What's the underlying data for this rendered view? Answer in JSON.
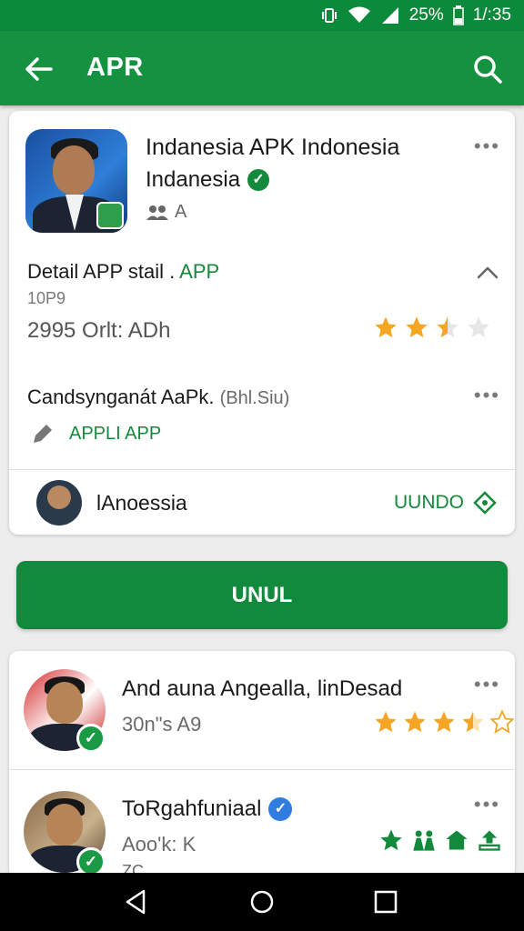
{
  "status_bar": {
    "battery": "25%",
    "time": "1/:35",
    "icons": [
      "vibrate-icon",
      "wifi-icon",
      "signal-icon",
      "battery-icon"
    ]
  },
  "app_bar": {
    "title": "APR",
    "back_icon": "arrow-left-icon",
    "search_icon": "search-icon"
  },
  "app_card": {
    "title": "Indanesia APK Indonesia",
    "developer": "Indanesia",
    "verified_mark": "✓",
    "meta": "A",
    "detail_label": "Detail APP stail .",
    "detail_label_accent": "APP",
    "detail_code": "10P9",
    "detail_stat": "2995 Orlt: ADh",
    "rating": 2.5,
    "subheading": "Candsynganát AaPk.",
    "subheading_muted": "(Bhl.Siu)",
    "apply_label": "APPLI APP",
    "developer_row_name": "lAnoessia",
    "developer_row_action": "UUNDO"
  },
  "primary_button": {
    "label": "UNUL"
  },
  "list": {
    "items": [
      {
        "title": "And auna Angealla, linDesad",
        "subtitle": "30n\"s A9",
        "rating": 3.5,
        "verified_mark": "✓"
      },
      {
        "title": "ToRgahfuniaal",
        "subtitle": "Aoo'k: K",
        "subtitle2": "ZC",
        "verified_mark": "✓",
        "blue_check": "✓"
      }
    ]
  },
  "colors": {
    "brand_green": "#14923f",
    "status_green": "#0b8a3c",
    "accent_green": "#138a3b",
    "star_yellow": "#f5a623",
    "verify_blue": "#2f7de1"
  }
}
